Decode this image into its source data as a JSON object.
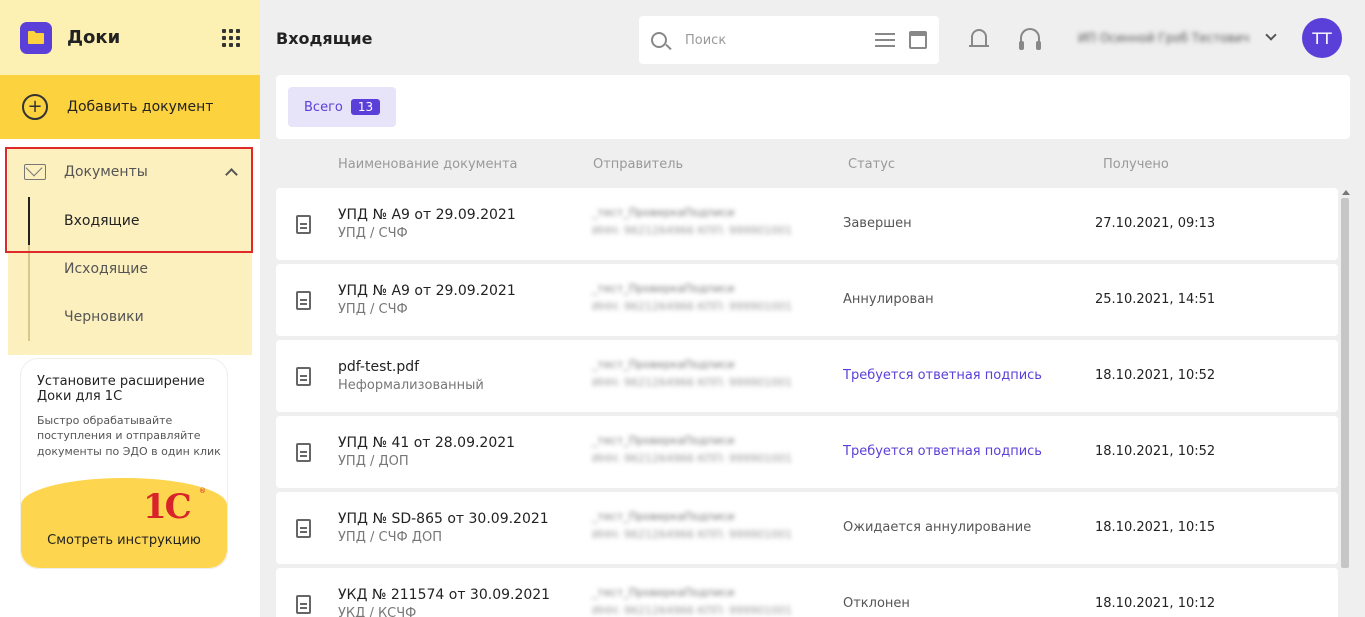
{
  "app": {
    "name": "Доки"
  },
  "sidebar": {
    "add_document": "Добавить документ",
    "group_label": "Документы",
    "items": [
      {
        "label": "Входящие",
        "active": true
      },
      {
        "label": "Исходящие",
        "active": false
      },
      {
        "label": "Черновики",
        "active": false
      }
    ],
    "promo": {
      "title": "Установите расширение Доки для 1С",
      "description": "Быстро обрабатывайте поступления и отправляйте документы по ЭДО в один клик",
      "logo": "1С",
      "button": "Смотреть инструкцию"
    }
  },
  "header": {
    "title": "Входящие",
    "search_placeholder": "Поиск",
    "org_name": "ИП Осинной Гроб Тестович",
    "avatar_initials": "ТТ"
  },
  "filter": {
    "label": "Всего",
    "count": "13"
  },
  "table": {
    "columns": [
      "Наименование документа",
      "Отправитель",
      "Статус",
      "Получено"
    ],
    "rows": [
      {
        "name": "УПД № А9 от 29.09.2021",
        "type": "УПД / СЧФ",
        "sender": "_тест_ПроверкаПодписи",
        "sender_inn": "ИНН: 9621264966 КПП: 999901001",
        "status": "Завершен",
        "status_link": false,
        "received": "27.10.2021, 09:13"
      },
      {
        "name": "УПД № А9 от 29.09.2021",
        "type": "УПД / СЧФ",
        "sender": "_тест_ПроверкаПодписи",
        "sender_inn": "ИНН: 9621264966 КПП: 999901001",
        "status": "Аннулирован",
        "status_link": false,
        "received": "25.10.2021, 14:51"
      },
      {
        "name": "pdf-test.pdf",
        "type": "Неформализованный",
        "sender": "_тест_ПроверкаПодписи",
        "sender_inn": "ИНН: 9621264966 КПП: 999901001",
        "status": "Требуется ответная подпись",
        "status_link": true,
        "received": "18.10.2021, 10:52"
      },
      {
        "name": "УПД № 41 от 28.09.2021",
        "type": "УПД / ДОП",
        "sender": "_тест_ПроверкаПодписи",
        "sender_inn": "ИНН: 9621264966 КПП: 999901001",
        "status": "Требуется ответная подпись",
        "status_link": true,
        "received": "18.10.2021, 10:52"
      },
      {
        "name": "УПД № SD-865 от 30.09.2021",
        "type": "УПД / СЧФ ДОП",
        "sender": "_тест_ПроверкаПодписи",
        "sender_inn": "ИНН: 9621264966 КПП: 999901001",
        "status": "Ожидается аннулирование",
        "status_link": false,
        "received": "18.10.2021, 10:15"
      },
      {
        "name": "УКД № 211574 от 30.09.2021",
        "type": "УКД / КСЧФ",
        "sender": "_тест_ПроверкаПодписи",
        "sender_inn": "ИНН: 9621264966 КПП: 999901001",
        "status": "Отклонен",
        "status_link": false,
        "received": "18.10.2021, 10:12"
      }
    ]
  },
  "colors": {
    "accent": "#5b3fd9",
    "brand_yellow": "#fdd23f",
    "highlight": "#e02a2a"
  }
}
